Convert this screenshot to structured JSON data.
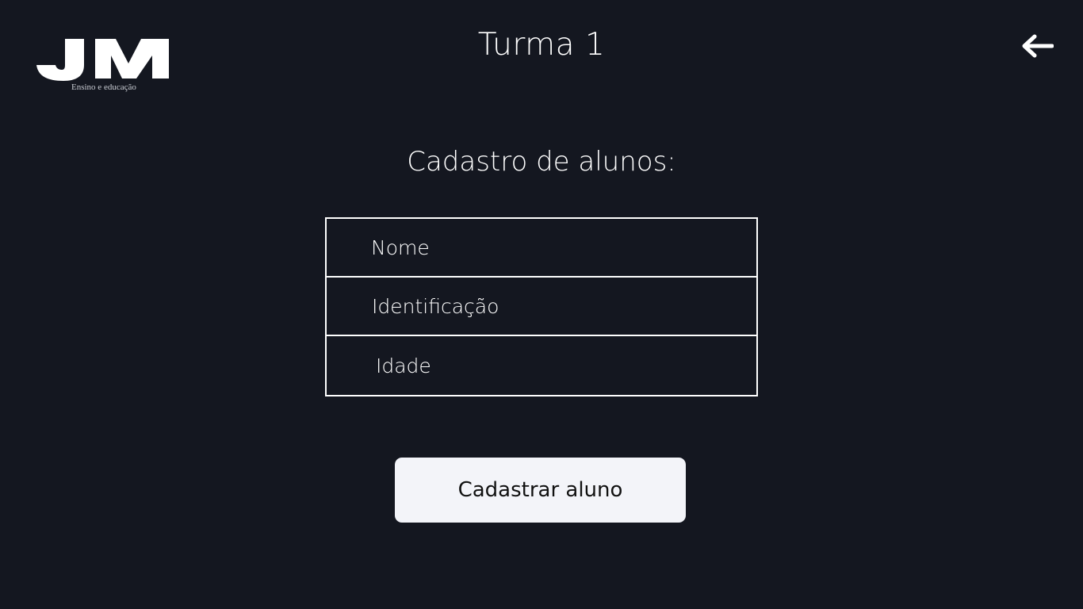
{
  "logo": {
    "mark_text": "JM",
    "subtitle": "Ensino e educação"
  },
  "header": {
    "title": "Turma 1",
    "back_icon": "arrow-left-icon"
  },
  "form": {
    "heading": "Cadastro de alunos:",
    "fields": [
      {
        "placeholder": "Nome",
        "value": ""
      },
      {
        "placeholder": "Identificação",
        "value": ""
      },
      {
        "placeholder": "Idade",
        "value": ""
      }
    ],
    "submit_label": "Cadastrar aluno"
  },
  "colors": {
    "background": "#141720",
    "foreground": "#ffffff",
    "button_background": "#f3f4f9",
    "button_text": "#111111"
  }
}
